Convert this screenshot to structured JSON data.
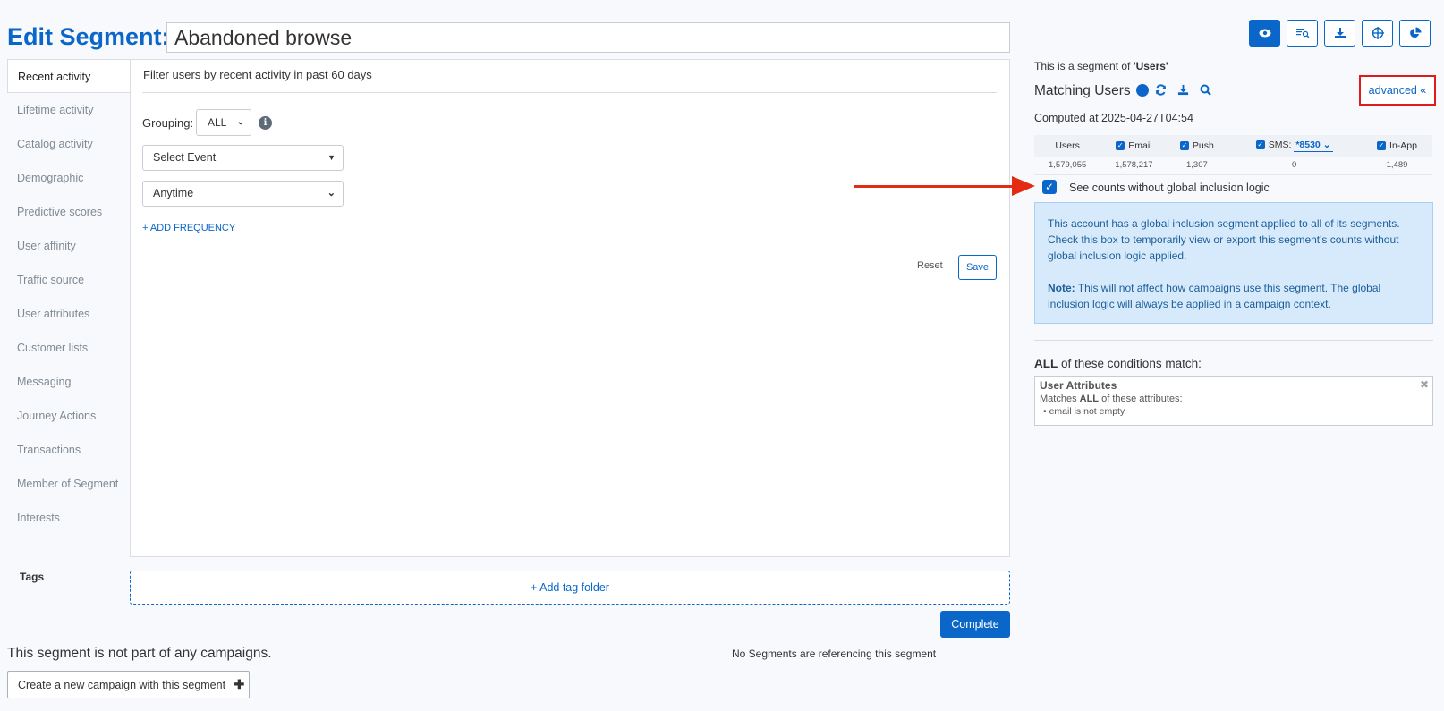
{
  "header": {
    "title_label": "Edit Segment:",
    "segment_name": "Abandoned browse"
  },
  "sidebar": {
    "items": [
      {
        "label": "Recent activity",
        "active": true
      },
      {
        "label": "Lifetime activity"
      },
      {
        "label": "Catalog activity"
      },
      {
        "label": "Demographic"
      },
      {
        "label": "Predictive scores"
      },
      {
        "label": "User affinity"
      },
      {
        "label": "Traffic source"
      },
      {
        "label": "User attributes"
      },
      {
        "label": "Customer lists"
      },
      {
        "label": "Messaging"
      },
      {
        "label": "Journey Actions"
      },
      {
        "label": "Transactions"
      },
      {
        "label": "Member of Segment"
      },
      {
        "label": "Interests"
      }
    ]
  },
  "filter": {
    "heading": "Filter users by recent activity in past 60 days",
    "grouping_label": "Grouping:",
    "grouping_value": "ALL",
    "event_select": "Select Event",
    "time_select": "Anytime",
    "add_frequency": "+ ADD FREQUENCY",
    "reset": "Reset",
    "save": "Save"
  },
  "tags": {
    "label": "Tags",
    "add_folder": "+ Add tag folder"
  },
  "footer": {
    "complete": "Complete",
    "not_part": "This segment is not part of any campaigns.",
    "no_segments": "No Segments are referencing this segment",
    "create_campaign": "Create a new campaign with this segment"
  },
  "toolbar": {
    "icons": [
      "eye-icon",
      "list-search-icon",
      "download-icon",
      "crosshair-icon",
      "pie-chart-icon"
    ]
  },
  "right_panel": {
    "segment_of_prefix": "This is a segment of ",
    "segment_of_value": "'Users'",
    "matching_users": "Matching Users",
    "advanced": "advanced «",
    "computed_at": "Computed at 2025-04-27T04:54",
    "table": {
      "headers": [
        "Users",
        "Email",
        "Push",
        "SMS:",
        "In-App"
      ],
      "sms_value": "*8530",
      "values": [
        "1,579,055",
        "1,578,217",
        "1,307",
        "0",
        "1,489"
      ]
    },
    "see_counts": "See counts without global inclusion logic",
    "info_text": "This account has a global inclusion segment applied to all of its segments. Check this box to temporarily view or export this segment's counts without global inclusion logic applied.",
    "note_label": "Note:",
    "note_text": " This will not affect how campaigns use this segment. The global inclusion logic will always be applied in a campaign context.",
    "all_label": "ALL",
    "all_suffix": " of these conditions match:",
    "condition": {
      "title": "User Attributes",
      "matches_prefix": "Matches ",
      "matches_all": "ALL",
      "matches_suffix": " of these attributes:",
      "item": "• email is not empty"
    }
  },
  "colors": {
    "accent": "#0a66c8",
    "highlight_red": "#e52a12",
    "info_bg": "#d7eafb"
  }
}
